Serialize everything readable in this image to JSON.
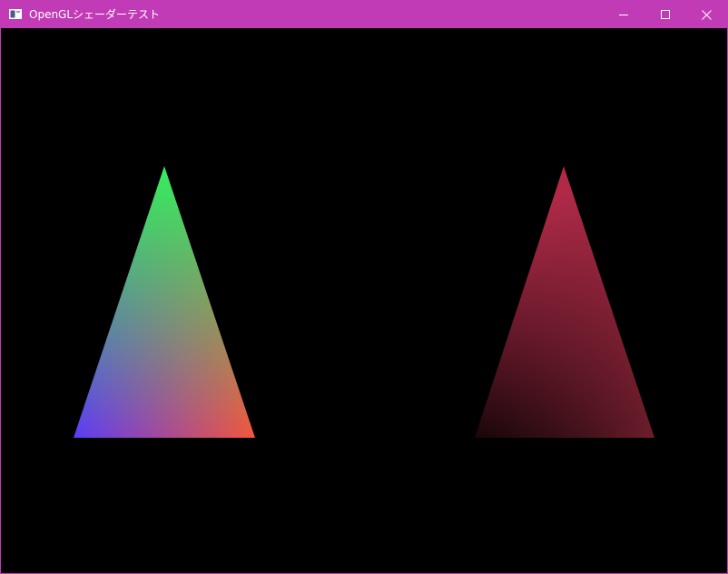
{
  "window": {
    "title": "OpenGLシェーダーテスト",
    "accent_color": "#c23bb6",
    "controls": {
      "minimize_icon": "minimize-icon",
      "maximize_icon": "maximize-icon",
      "close_icon": "close-icon"
    }
  },
  "viewport": {
    "background_color": "#000000",
    "triangles": [
      {
        "name": "vertex-color-triangle",
        "vertex_colors": {
          "top": "#35ee5a",
          "bottom_left": "#5a3cf7",
          "bottom_right": "#f5553b"
        }
      },
      {
        "name": "red-gradient-triangle",
        "vertex_colors": {
          "top": "#b02a48",
          "bottom_left": "#000000",
          "bottom_right": "#6e1d2c"
        }
      }
    ]
  }
}
